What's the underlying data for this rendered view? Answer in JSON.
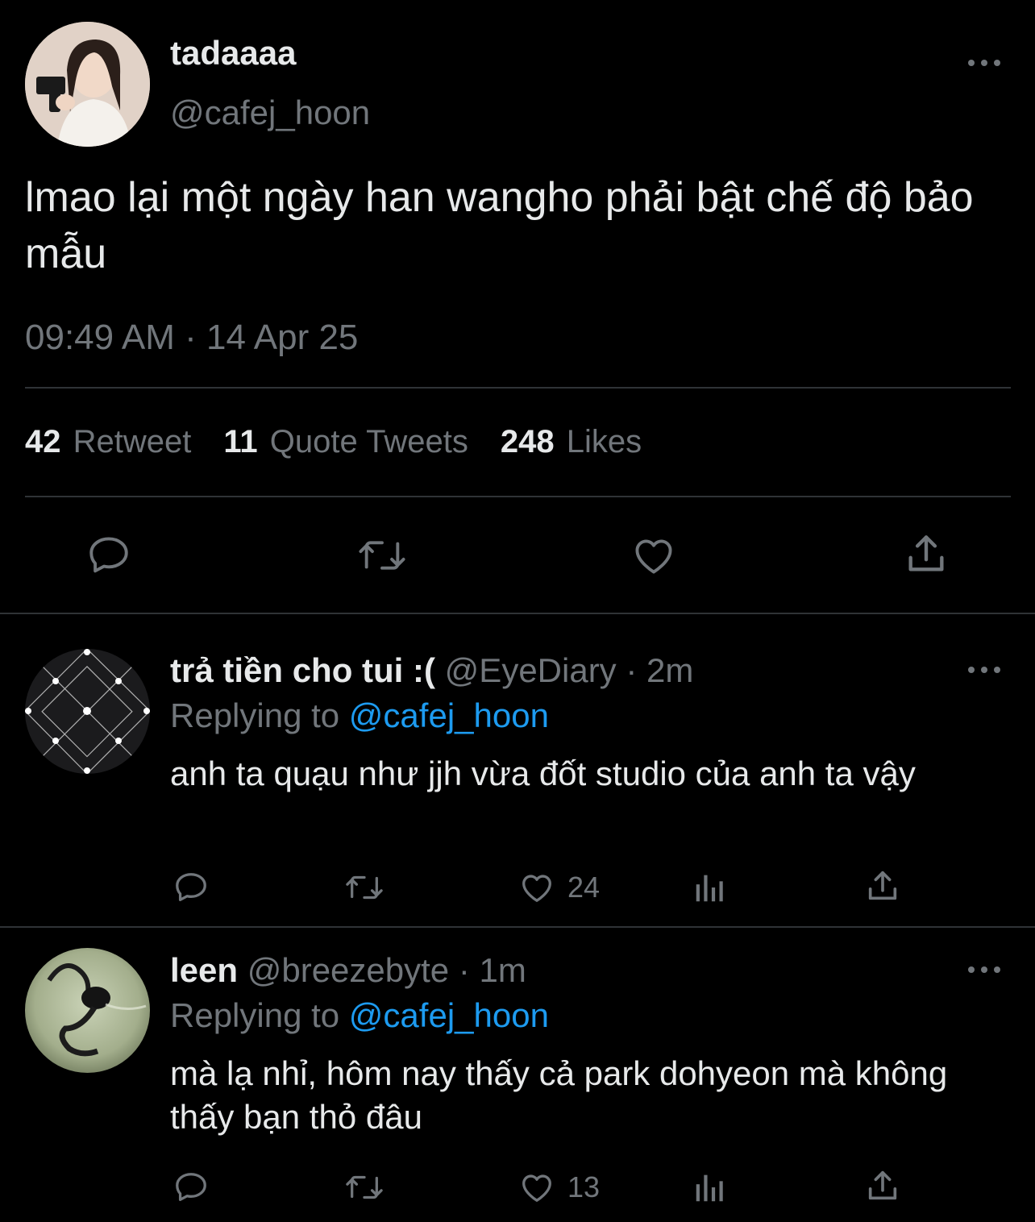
{
  "colors": {
    "background": "#000000",
    "text": "#e7e9ea",
    "muted": "#71767b",
    "link": "#1d9bf0",
    "divider": "#2f3336"
  },
  "main_tweet": {
    "display_name": "tadaaaa",
    "handle": "@cafej_hoon",
    "text": "lmao lại một ngày han wangho phải bật chế độ bảo mẫu",
    "timestamp": "09:49 AM · 14 Apr 25",
    "stats": {
      "retweets": "42",
      "retweets_label": "Retweet",
      "quotes": "11",
      "quotes_label": "Quote Tweets",
      "likes": "248",
      "likes_label": "Likes"
    },
    "icons": [
      "reply-icon",
      "retweet-icon",
      "like-icon",
      "share-icon"
    ]
  },
  "replies": [
    {
      "display_name": "trả tiền cho tui :(",
      "handle": "@EyeDiary",
      "time": "2m",
      "replying_prefix": "Replying to",
      "replying_to": "@cafej_hoon",
      "text": "anh ta quạu như jjh vừa đốt studio của anh ta vậy",
      "like_count": "24"
    },
    {
      "display_name": "leen",
      "handle": "@breezebyte",
      "time": "1m",
      "replying_prefix": "Replying to",
      "replying_to": "@cafej_hoon",
      "text": "mà lạ nhỉ, hôm nay thấy cả park dohyeon mà không thấy bạn thỏ đâu",
      "like_count": "13"
    }
  ]
}
